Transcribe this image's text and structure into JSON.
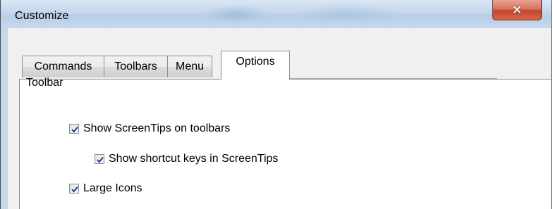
{
  "window": {
    "title": "Customize",
    "close_icon": "×"
  },
  "tabs": [
    {
      "label": "Commands",
      "active": false
    },
    {
      "label": "Toolbars",
      "active": false
    },
    {
      "label": "Menu",
      "active": false
    },
    {
      "label": "Options",
      "active": true
    }
  ],
  "options": {
    "toolbar_group": {
      "label": "Toolbar",
      "items": [
        {
          "label": "Show ScreenTips on toolbars",
          "checked": true
        },
        {
          "label": "Show shortcut keys in ScreenTips",
          "checked": true
        },
        {
          "label": "Large Icons",
          "checked": true
        }
      ]
    }
  },
  "colors": {
    "close_button": "#c4452c",
    "checkmark": "#1d3e8a"
  }
}
